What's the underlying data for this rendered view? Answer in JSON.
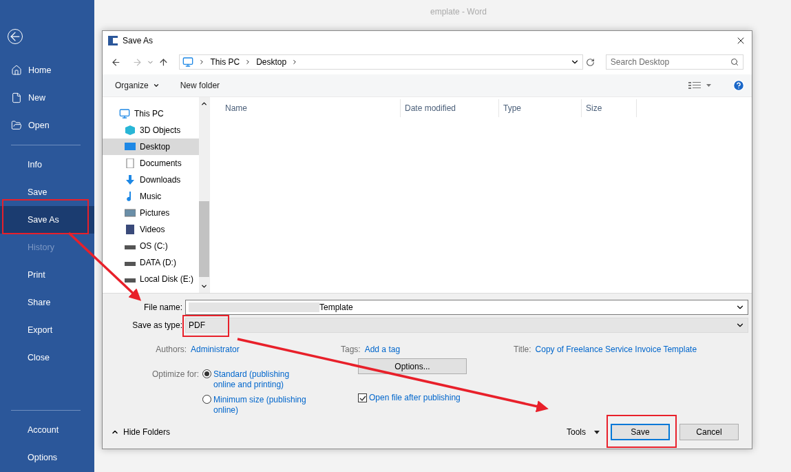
{
  "backstage": {
    "sections": [
      [
        {
          "label": "Home",
          "selected": false,
          "disabled": false
        },
        {
          "label": "New",
          "selected": false,
          "disabled": false
        },
        {
          "label": "Open",
          "selected": false,
          "disabled": false
        }
      ],
      [
        {
          "label": "Info",
          "selected": false,
          "disabled": false
        },
        {
          "label": "Save",
          "selected": false,
          "disabled": false
        },
        {
          "label": "Save As",
          "selected": true,
          "disabled": false
        },
        {
          "label": "History",
          "selected": false,
          "disabled": true
        },
        {
          "label": "Print",
          "selected": false,
          "disabled": false
        },
        {
          "label": "Share",
          "selected": false,
          "disabled": false
        },
        {
          "label": "Export",
          "selected": false,
          "disabled": false
        },
        {
          "label": "Close",
          "selected": false,
          "disabled": false
        }
      ],
      [
        {
          "label": "Account",
          "selected": false,
          "disabled": false
        },
        {
          "label": "Options",
          "selected": false,
          "disabled": false
        }
      ]
    ]
  },
  "app_title": "emplate - Word",
  "dialog": {
    "title": "Save As",
    "breadcrumb": [
      "This PC",
      "Desktop"
    ],
    "search": {
      "placeholder": "Search Desktop"
    },
    "toolbar": [
      "Organize",
      "New folder"
    ],
    "tree": [
      {
        "label": "This PC",
        "selected": false,
        "children": [
          {
            "label": "3D Objects",
            "selected": false
          },
          {
            "label": "Desktop",
            "selected": true
          },
          {
            "label": "Documents",
            "selected": false
          },
          {
            "label": "Downloads",
            "selected": false
          },
          {
            "label": "Music",
            "selected": false
          },
          {
            "label": "Pictures",
            "selected": false
          },
          {
            "label": "Videos",
            "selected": false
          },
          {
            "label": "OS (C:)",
            "selected": false
          },
          {
            "label": "DATA (D:)",
            "selected": false
          },
          {
            "label": "Local Disk (E:)",
            "selected": false
          }
        ]
      }
    ],
    "columns": [
      "Name",
      "Date modified",
      "Type",
      "Size"
    ],
    "file_name": {
      "label": "File name:",
      "value": "Template"
    },
    "save_type": {
      "label": "Save as type:",
      "value": "PDF"
    },
    "meta": [
      {
        "label": "Authors:",
        "value": "Administrator"
      },
      {
        "label": "Tags:",
        "value": "Add a tag"
      },
      {
        "label": "Title:",
        "value": "Copy of Freelance Service Invoice Template"
      }
    ],
    "optimize": {
      "label": "Optimize for:",
      "options": [
        {
          "label": "Standard (publishing online and printing)",
          "selected": true
        },
        {
          "label": "Minimum size (publishing online)",
          "selected": false
        }
      ]
    },
    "options_button": "Options...",
    "open_after": {
      "label": "Open file after publishing",
      "checked": true
    },
    "hide_folders": "Hide Folders",
    "tools": "Tools",
    "buttons": [
      "Save",
      "Cancel"
    ]
  }
}
